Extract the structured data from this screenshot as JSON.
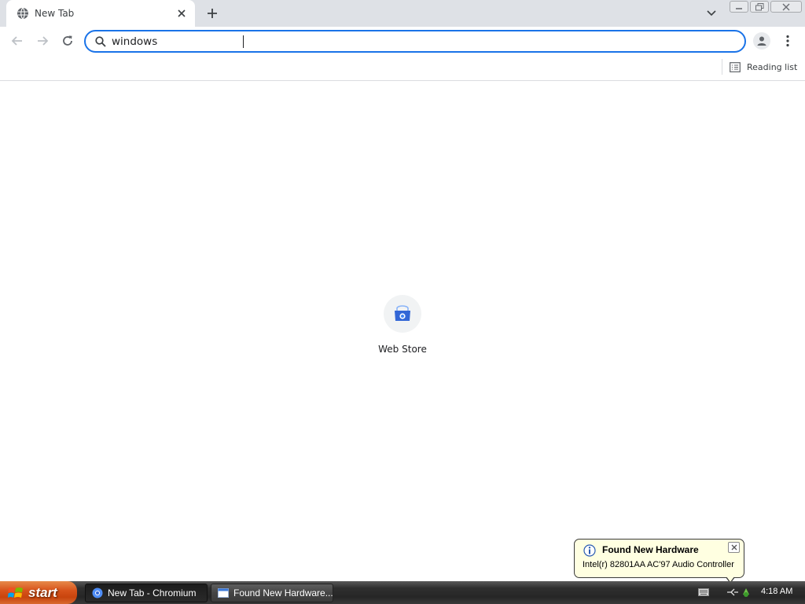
{
  "window": {
    "tab_title": "New Tab",
    "controls": [
      "minimize",
      "restore",
      "close"
    ]
  },
  "toolbar": {
    "omnibox_value": "windows ",
    "icons": [
      "back-arrow-icon",
      "forward-arrow-icon",
      "reload-icon",
      "search-icon",
      "profile-icon",
      "menu-icon"
    ]
  },
  "bookmarks_bar": {
    "reading_list_label": "Reading list"
  },
  "content": {
    "shortcuts": [
      {
        "label": "Web Store",
        "icon": "web-store-icon"
      }
    ]
  },
  "notification": {
    "title": "Found New Hardware",
    "text": "Intel(r) 82801AA AC'97 Audio Controller",
    "icon": "info-icon"
  },
  "taskbar": {
    "start_label": "start",
    "tasks": [
      {
        "label": "New Tab - Chromium",
        "active": true,
        "icon": "chromium-icon"
      },
      {
        "label": "Found New Hardware...",
        "active": false,
        "icon": "window-icon"
      }
    ],
    "clock": "4:18 AM"
  },
  "colors": {
    "accent": "#1a73e8",
    "tabstrip": "#dee1e6",
    "balloon_bg": "#ffffe1",
    "start_orange": "#d8541b",
    "taskbar_dark": "#2f2f2f"
  }
}
